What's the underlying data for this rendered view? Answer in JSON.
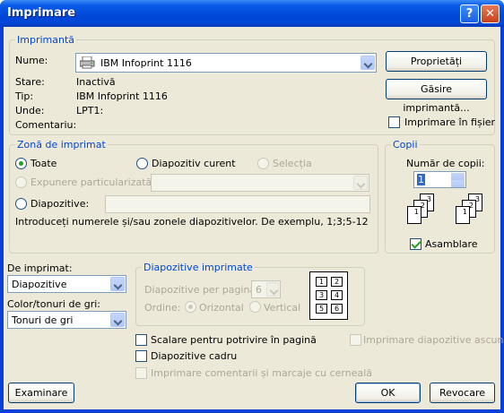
{
  "window": {
    "title": "Imprimare",
    "help_label": "?",
    "close_label": "✕"
  },
  "printer": {
    "group_label": "Imprimantă",
    "name_label": "Nume:",
    "name_value": "IBM Infoprint 1116",
    "status_label": "Stare:",
    "status_value": "Inactivă",
    "type_label": "Tip:",
    "type_value": "IBM Infoprint 1116",
    "where_label": "Unde:",
    "where_value": "LPT1:",
    "comment_label": "Comentariu:",
    "properties_button": "Proprietăți",
    "find_button": "Găsire imprimantă...",
    "print_to_file_label": "Imprimare în fișier"
  },
  "range": {
    "group_label": "Zonă de imprimat",
    "all_label": "Toate",
    "current_label": "Diapozitiv curent",
    "selection_label": "Selecția",
    "custom_show_label": "Expunere particularizată:",
    "slides_label": "Diapozitive:",
    "hint": "Introduceți numerele și/sau zonele diapozitivelor. De exemplu, 1;3;5-12"
  },
  "copies": {
    "group_label": "Copii",
    "count_label": "Număr de copii:",
    "count_value": "1",
    "collate_label": "Asamblare"
  },
  "print_what": {
    "label": "De imprimat:",
    "value": "Diapozitive"
  },
  "color": {
    "label": "Color/tonuri de gri:",
    "value": "Tonuri de gri"
  },
  "handouts": {
    "group_label": "Diapozitive imprimate",
    "per_page_label": "Diapozitive per pagină:",
    "per_page_value": "6",
    "order_label": "Ordine:",
    "horizontal_label": "Orizontal",
    "vertical_label": "Vertical",
    "preview_cells": [
      "1",
      "2",
      "3",
      "4",
      "5",
      "6"
    ]
  },
  "options": {
    "scale_label": "Scalare pentru potrivire în pagină",
    "frame_label": "Diapozitive cadru",
    "comments_label": "Imprimare comentarii și marcaje cu cerneală",
    "hidden_label": "Imprimare diapozitive ascunse"
  },
  "buttons": {
    "preview": "Examinare",
    "ok": "OK",
    "cancel": "Revocare"
  }
}
